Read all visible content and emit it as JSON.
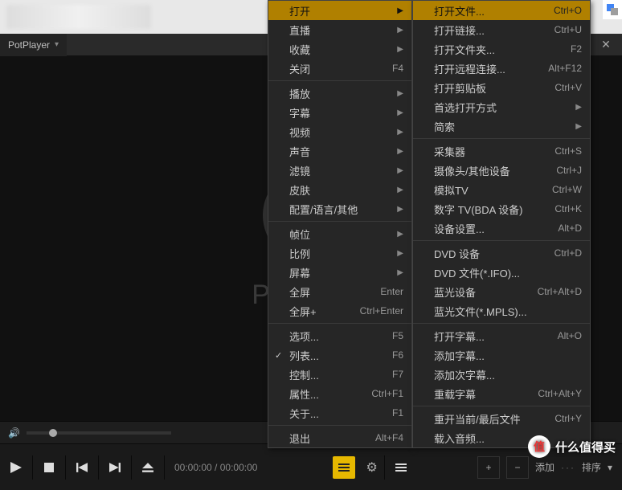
{
  "app": {
    "name": "PotPlayer",
    "brand": "PotPlayer"
  },
  "time": {
    "current": "00:00:00",
    "total": "00:00:00",
    "sep": " / "
  },
  "menu_main": [
    {
      "label": "打开",
      "highlight": true,
      "arrow": true
    },
    {
      "label": "直播",
      "arrow": true
    },
    {
      "label": "收藏",
      "arrow": true
    },
    {
      "label": "关闭",
      "shortcut": "F4"
    },
    {
      "sep": true
    },
    {
      "label": "播放",
      "arrow": true
    },
    {
      "label": "字幕",
      "arrow": true
    },
    {
      "label": "视频",
      "arrow": true
    },
    {
      "label": "声音",
      "arrow": true
    },
    {
      "label": "滤镜",
      "arrow": true
    },
    {
      "label": "皮肤",
      "arrow": true
    },
    {
      "label": "配置/语言/其他",
      "arrow": true
    },
    {
      "sep": true
    },
    {
      "label": "帧位",
      "arrow": true
    },
    {
      "label": "比例",
      "arrow": true
    },
    {
      "label": "屏幕",
      "arrow": true
    },
    {
      "label": "全屏",
      "shortcut": "Enter"
    },
    {
      "label": "全屏+",
      "shortcut": "Ctrl+Enter"
    },
    {
      "sep": true
    },
    {
      "label": "选项...",
      "shortcut": "F5"
    },
    {
      "label": "列表...",
      "shortcut": "F6",
      "checked": true
    },
    {
      "label": "控制...",
      "shortcut": "F7"
    },
    {
      "label": "属性...",
      "shortcut": "Ctrl+F1"
    },
    {
      "label": "关于...",
      "shortcut": "F1"
    },
    {
      "sep": true
    },
    {
      "label": "退出",
      "shortcut": "Alt+F4"
    }
  ],
  "menu_open": [
    {
      "label": "打开文件...",
      "shortcut": "Ctrl+O",
      "highlight": true
    },
    {
      "label": "打开链接...",
      "shortcut": "Ctrl+U"
    },
    {
      "label": "打开文件夹...",
      "shortcut": "F2"
    },
    {
      "label": "打开远程连接...",
      "shortcut": "Alt+F12"
    },
    {
      "label": "打开剪贴板",
      "shortcut": "Ctrl+V"
    },
    {
      "label": "首选打开方式",
      "arrow": true
    },
    {
      "label": "简索",
      "arrow": true
    },
    {
      "sep": true
    },
    {
      "label": "采集器",
      "shortcut": "Ctrl+S"
    },
    {
      "label": "摄像头/其他设备",
      "shortcut": "Ctrl+J"
    },
    {
      "label": "模拟TV",
      "shortcut": "Ctrl+W"
    },
    {
      "label": "数字 TV(BDA 设备)",
      "shortcut": "Ctrl+K"
    },
    {
      "label": "设备设置...",
      "shortcut": "Alt+D"
    },
    {
      "sep": true
    },
    {
      "label": "DVD 设备",
      "shortcut": "Ctrl+D"
    },
    {
      "label": "DVD 文件(*.IFO)..."
    },
    {
      "label": "蓝光设备",
      "shortcut": "Ctrl+Alt+D"
    },
    {
      "label": "蓝光文件(*.MPLS)..."
    },
    {
      "sep": true
    },
    {
      "label": "打开字幕...",
      "shortcut": "Alt+O"
    },
    {
      "label": "添加字幕..."
    },
    {
      "label": "添加次字幕..."
    },
    {
      "label": "重载字幕",
      "shortcut": "Ctrl+Alt+Y"
    },
    {
      "sep": true
    },
    {
      "label": "重开当前/最后文件",
      "shortcut": "Ctrl+Y"
    },
    {
      "label": "载入音频..."
    }
  ],
  "footer_right": {
    "text_prefix": "添加",
    "text_suffix": "排序"
  },
  "watermark": {
    "badge": "值",
    "text": "什么值得买"
  }
}
